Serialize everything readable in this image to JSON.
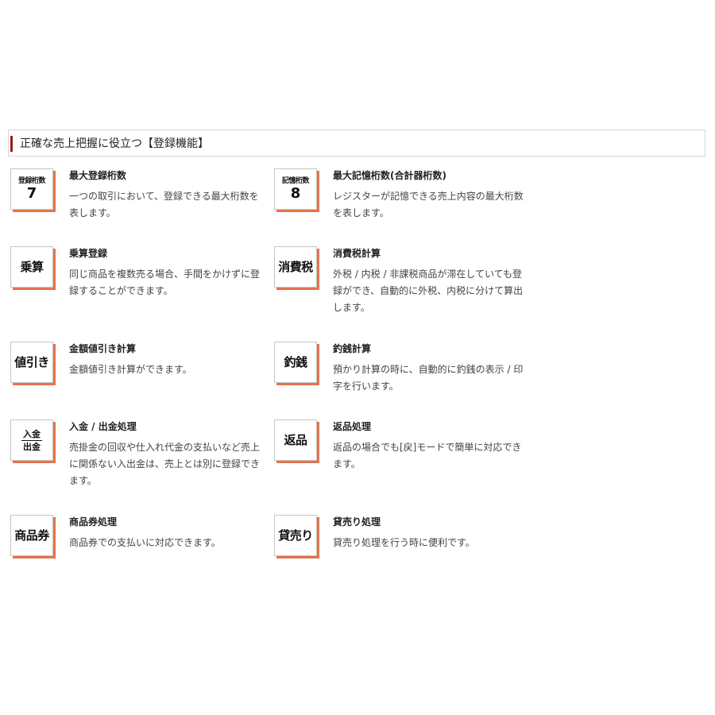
{
  "section": {
    "title": "正確な売上把握に役立つ【登録機能】"
  },
  "features": [
    {
      "icon_small": "登録桁数",
      "icon_digit": "7",
      "title": "最大登録桁数",
      "desc": "一つの取引において、登録できる最大桁数を表します。"
    },
    {
      "icon_small": "記憶桁数",
      "icon_digit": "8",
      "title": "最大記憶桁数(合計器桁数)",
      "desc": "レジスターが記憶できる売上内容の最大桁数を表します。"
    },
    {
      "icon_label": "乗算",
      "title": "乗算登録",
      "desc": "同じ商品を複数売る場合、手間をかけずに登録することができます。"
    },
    {
      "icon_label": "消費税",
      "title": "消費税計算",
      "desc": "外税 / 内税 / 非課税商品が滞在していても登録ができ、自動的に外税、内税に分けて算出します。"
    },
    {
      "icon_label": "値引き",
      "title": "金額値引き計算",
      "desc": "金額値引き計算ができます。"
    },
    {
      "icon_label": "釣銭",
      "title": "釣銭計算",
      "desc": "預かり計算の時に、自動的に釣銭の表示 / 印字を行います。"
    },
    {
      "icon_top": "入金",
      "icon_bottom": "出金",
      "title": "入金 / 出金処理",
      "desc": "売掛金の回収や仕入れ代金の支払いなど売上に関係ない入出金は、売上とは別に登録できます。"
    },
    {
      "icon_label": "返品",
      "title": "返品処理",
      "desc": "返品の場合でも[戻]モードで簡単に対応できます。"
    },
    {
      "icon_label": "商品券",
      "title": "商品券処理",
      "desc": "商品券での支払いに対応できます。"
    },
    {
      "icon_label": "貸売り",
      "title": "貸売り処理",
      "desc": "貸売り処理を行う時に便利です。"
    }
  ],
  "colors": {
    "accent_bar": "#9c1a1a",
    "icon_shadow": "#e5734a"
  }
}
